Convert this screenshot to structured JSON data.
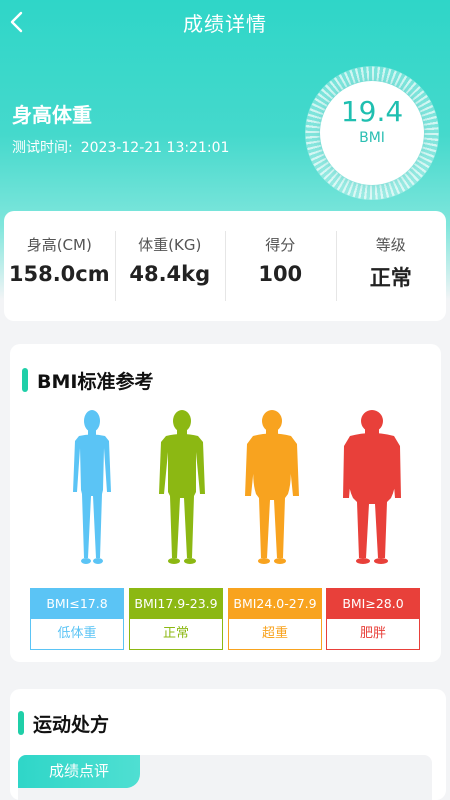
{
  "nav": {
    "title": "成绩详情"
  },
  "profile": {
    "title": "身高体重",
    "test_time_label": "测试时间:",
    "test_time_value": "2023-12-21 13:21:01",
    "bmi_value": "19.4",
    "bmi_unit": "BMI"
  },
  "stats": [
    {
      "label": "身高(CM)",
      "value": "158.0cm"
    },
    {
      "label": "体重(KG)",
      "value": "48.4kg"
    },
    {
      "label": "得分",
      "value": "100"
    },
    {
      "label": "等级",
      "value": "正常"
    }
  ],
  "bmi_reference": {
    "title": "BMI标准参考",
    "levels": [
      {
        "range": "BMI≤17.8",
        "name": "低体重",
        "color": "#5bc4f5"
      },
      {
        "range": "BMI17.9-23.9",
        "name": "正常",
        "color": "#8cb813"
      },
      {
        "range": "BMI24.0-27.9",
        "name": "超重",
        "color": "#f8a31f"
      },
      {
        "range": "BMI≥28.0",
        "name": "肥胖",
        "color": "#e8403a"
      }
    ]
  },
  "exercise": {
    "title": "运动处方",
    "tab_active": "成绩点评"
  },
  "colors": {
    "accent": "#2fd6c8",
    "section_bar": "#1fcfa8"
  },
  "icons": {
    "back": "chevron-left-icon"
  }
}
